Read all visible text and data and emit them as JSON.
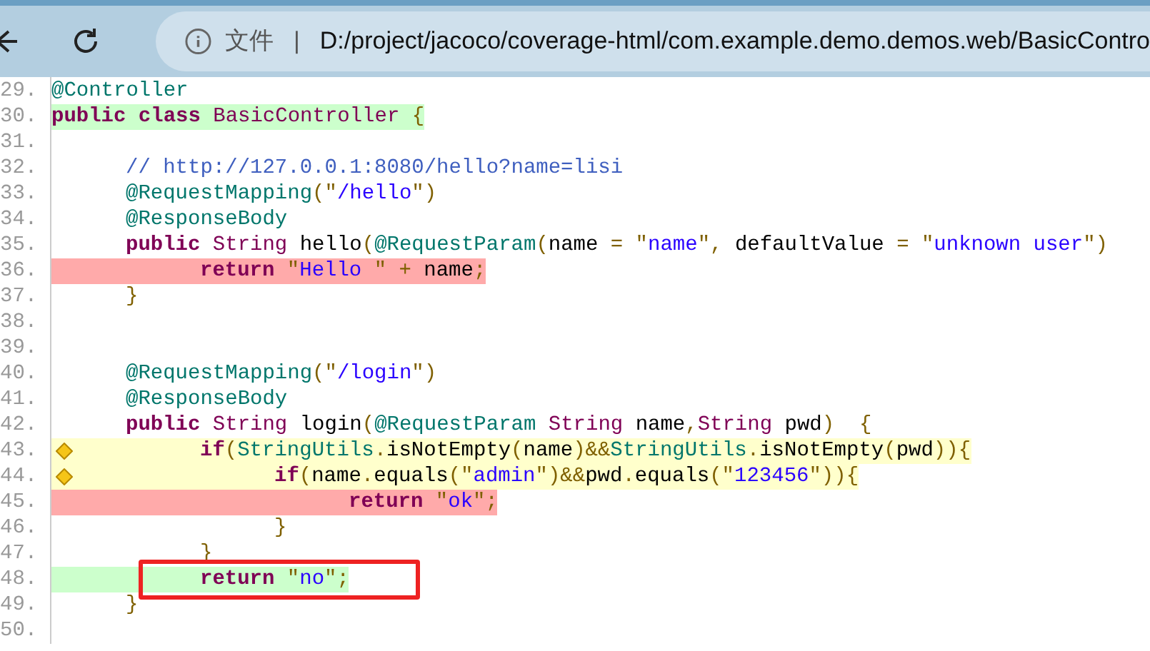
{
  "toolbar": {
    "scheme_label": "文件",
    "separator": "|",
    "url": "D:/project/jacoco/coverage-html/com.example.demo.demos.web/BasicContro"
  },
  "lines": [
    {
      "number": "29.",
      "tokens": [
        {
          "kind": "annotation",
          "text": "@Controller"
        }
      ]
    },
    {
      "number": "30.",
      "color": "#ccffcc",
      "tokens": [
        {
          "kind": "keyword",
          "text": "public class "
        },
        {
          "kind": "type",
          "text": "BasicController "
        },
        {
          "kind": "punct",
          "text": "{"
        }
      ]
    },
    {
      "number": "31."
    },
    {
      "number": "32.",
      "tokens": [
        {
          "kind": "comment",
          "text": "\t// http://127.0.0.1:8080/hello?name=lisi"
        }
      ]
    },
    {
      "number": "33.",
      "tokens": [
        {
          "kind": "annotation",
          "text": "\t@RequestMapping"
        },
        {
          "kind": "punct",
          "text": "(\""
        },
        {
          "kind": "string",
          "text": "/hello"
        },
        {
          "kind": "punct",
          "text": "\")"
        }
      ]
    },
    {
      "number": "34.",
      "tokens": [
        {
          "kind": "annotation",
          "text": "\t@ResponseBody"
        }
      ]
    },
    {
      "number": "35.",
      "tokens": [
        {
          "kind": "keyword",
          "text": "\tpublic "
        },
        {
          "kind": "type",
          "text": "String "
        },
        {
          "kind": "plain",
          "text": "hello"
        },
        {
          "kind": "punct",
          "text": "("
        },
        {
          "kind": "annotation",
          "text": "@RequestParam"
        },
        {
          "kind": "punct",
          "text": "("
        },
        {
          "kind": "plain",
          "text": "name "
        },
        {
          "kind": "punct",
          "text": "= \""
        },
        {
          "kind": "string",
          "text": "name"
        },
        {
          "kind": "punct",
          "text": "\", "
        },
        {
          "kind": "plain",
          "text": "defaultValue "
        },
        {
          "kind": "punct",
          "text": "= \""
        },
        {
          "kind": "string",
          "text": "unknown user"
        },
        {
          "kind": "punct",
          "text": "\")"
        }
      ]
    },
    {
      "number": "36.",
      "color": "#ffaaaa",
      "tokens": [
        {
          "kind": "keyword",
          "text": "\t\treturn "
        },
        {
          "kind": "punct",
          "text": "\""
        },
        {
          "kind": "string",
          "text": "Hello "
        },
        {
          "kind": "punct",
          "text": "\" + "
        },
        {
          "kind": "plain",
          "text": "name"
        },
        {
          "kind": "punct",
          "text": ";"
        }
      ]
    },
    {
      "number": "37.",
      "tokens": [
        {
          "kind": "punct",
          "text": "\t}"
        }
      ]
    },
    {
      "number": "38."
    },
    {
      "number": "39."
    },
    {
      "number": "40.",
      "tokens": [
        {
          "kind": "annotation",
          "text": "\t@RequestMapping"
        },
        {
          "kind": "punct",
          "text": "(\""
        },
        {
          "kind": "string",
          "text": "/login"
        },
        {
          "kind": "punct",
          "text": "\")"
        }
      ]
    },
    {
      "number": "41.",
      "tokens": [
        {
          "kind": "annotation",
          "text": "\t@ResponseBody"
        }
      ]
    },
    {
      "number": "42.",
      "tokens": [
        {
          "kind": "keyword",
          "text": "\tpublic "
        },
        {
          "kind": "type",
          "text": "String "
        },
        {
          "kind": "plain",
          "text": "login"
        },
        {
          "kind": "punct",
          "text": "("
        },
        {
          "kind": "annotation",
          "text": "@RequestParam "
        },
        {
          "kind": "type",
          "text": "String "
        },
        {
          "kind": "plain",
          "text": "name"
        },
        {
          "kind": "punct",
          "text": ","
        },
        {
          "kind": "type",
          "text": "String "
        },
        {
          "kind": "plain",
          "text": "pwd"
        },
        {
          "kind": "punct",
          "text": ")  {"
        }
      ]
    },
    {
      "number": "43.",
      "color": "#ffffcc",
      "branch": true,
      "tokens": [
        {
          "kind": "keyword",
          "text": "\t\tif"
        },
        {
          "kind": "punct",
          "text": "("
        },
        {
          "kind": "annotation",
          "text": "StringUtils"
        },
        {
          "kind": "punct",
          "text": "."
        },
        {
          "kind": "plain",
          "text": "isNotEmpty"
        },
        {
          "kind": "punct",
          "text": "("
        },
        {
          "kind": "plain",
          "text": "name"
        },
        {
          "kind": "punct",
          "text": ")&&"
        },
        {
          "kind": "annotation",
          "text": "StringUtils"
        },
        {
          "kind": "punct",
          "text": "."
        },
        {
          "kind": "plain",
          "text": "isNotEmpty"
        },
        {
          "kind": "punct",
          "text": "("
        },
        {
          "kind": "plain",
          "text": "pwd"
        },
        {
          "kind": "punct",
          "text": ")){"
        }
      ]
    },
    {
      "number": "44.",
      "color": "#ffffcc",
      "branch": true,
      "tokens": [
        {
          "kind": "keyword",
          "text": "\t\t\tif"
        },
        {
          "kind": "punct",
          "text": "("
        },
        {
          "kind": "plain",
          "text": "name"
        },
        {
          "kind": "punct",
          "text": "."
        },
        {
          "kind": "plain",
          "text": "equals"
        },
        {
          "kind": "punct",
          "text": "(\""
        },
        {
          "kind": "string",
          "text": "admin"
        },
        {
          "kind": "punct",
          "text": "\")&&"
        },
        {
          "kind": "plain",
          "text": "pwd"
        },
        {
          "kind": "punct",
          "text": "."
        },
        {
          "kind": "plain",
          "text": "equals"
        },
        {
          "kind": "punct",
          "text": "(\""
        },
        {
          "kind": "string",
          "text": "123456"
        },
        {
          "kind": "punct",
          "text": "\")){"
        }
      ]
    },
    {
      "number": "45.",
      "color": "#ffaaaa",
      "tokens": [
        {
          "kind": "keyword",
          "text": "\t\t\t\treturn "
        },
        {
          "kind": "punct",
          "text": "\""
        },
        {
          "kind": "string",
          "text": "ok"
        },
        {
          "kind": "punct",
          "text": "\";"
        }
      ]
    },
    {
      "number": "46.",
      "tokens": [
        {
          "kind": "punct",
          "text": "\t\t\t}"
        }
      ]
    },
    {
      "number": "47.",
      "tokens": [
        {
          "kind": "punct",
          "text": "\t\t}"
        }
      ]
    },
    {
      "number": "48.",
      "color": "#ccffcc",
      "boxed": true,
      "tokens": [
        {
          "kind": "keyword",
          "text": "\t\treturn "
        },
        {
          "kind": "punct",
          "text": "\""
        },
        {
          "kind": "string",
          "text": "no"
        },
        {
          "kind": "punct",
          "text": "\";"
        }
      ]
    },
    {
      "number": "49.",
      "tokens": [
        {
          "kind": "punct",
          "text": "\t}"
        }
      ]
    },
    {
      "number": "50."
    }
  ]
}
